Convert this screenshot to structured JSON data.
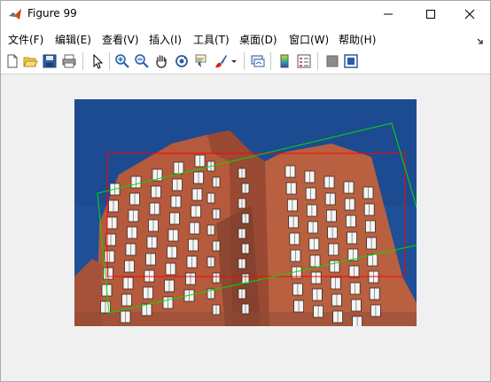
{
  "window": {
    "title": "Figure 99",
    "controls": {
      "minimize": "minimize",
      "maximize": "maximize",
      "close": "close"
    }
  },
  "menubar": {
    "items": [
      {
        "label": "文件(F)"
      },
      {
        "label": "编辑(E)"
      },
      {
        "label": "查看(V)"
      },
      {
        "label": "插入(I)"
      },
      {
        "label": "工具(T)"
      },
      {
        "label": "桌面(D)"
      },
      {
        "label": "窗口(W)"
      },
      {
        "label": "帮助(H)"
      }
    ]
  },
  "toolbar": {
    "icons": [
      "new-figure-icon",
      "open-file-icon",
      "save-icon",
      "print-icon",
      "pointer-icon",
      "zoom-in-icon",
      "zoom-out-icon",
      "pan-icon",
      "rotate-3d-icon",
      "data-cursor-icon",
      "brush-icon",
      "brush-dropdown-icon",
      "link-plot-icon",
      "insert-colorbar-icon",
      "insert-legend-icon",
      "hide-plot-tools-icon",
      "show-plot-tools-icon"
    ]
  },
  "image": {
    "subject": "building-photo",
    "colors": {
      "sky": "#1f4f96",
      "brick": "#b55a3c",
      "window": "#f4f4f4"
    },
    "overlays": [
      {
        "name": "red-rectangle",
        "color": "#ff0000"
      },
      {
        "name": "green-rotated-rectangle",
        "color": "#00e000"
      }
    ]
  }
}
